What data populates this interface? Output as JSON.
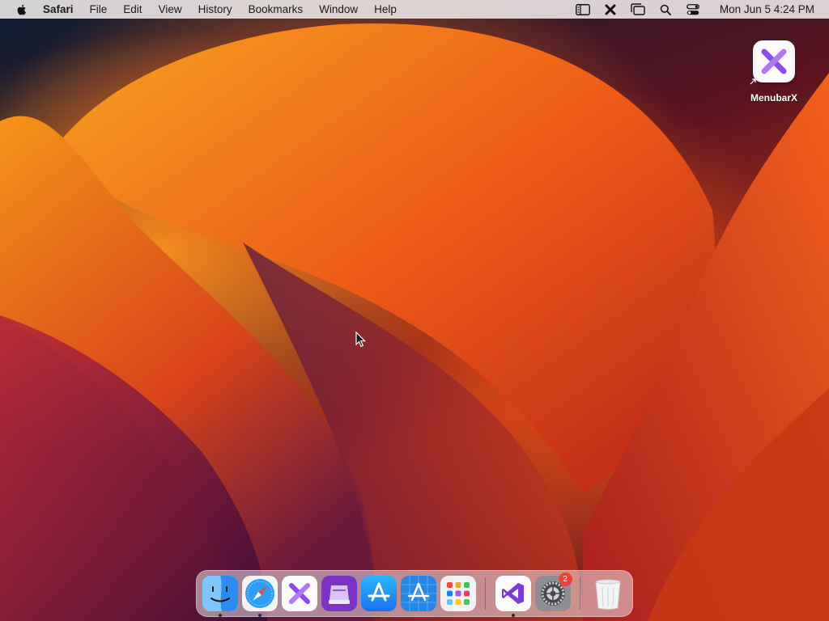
{
  "menubar": {
    "app_name": "Safari",
    "items": [
      "File",
      "Edit",
      "View",
      "History",
      "Bookmarks",
      "Window",
      "Help"
    ],
    "status_icons": [
      "sidebar-list-icon",
      "menubarx-icon",
      "window-stack-icon",
      "search-icon",
      "control-center-icon"
    ],
    "clock": "Mon Jun 5  4:24 PM"
  },
  "desktop": {
    "icon_label": "MenubarX"
  },
  "dock": {
    "apps": [
      {
        "name": "Finder",
        "icon": "finder-icon",
        "running": true
      },
      {
        "name": "Safari",
        "icon": "safari-icon",
        "running": true
      },
      {
        "name": "MenubarX",
        "icon": "menubarx-icon",
        "running": false
      },
      {
        "name": "Apple Configurator",
        "icon": "configurator-icon",
        "running": false
      },
      {
        "name": "App Store",
        "icon": "app-store-icon",
        "running": false
      },
      {
        "name": "Xcode Instruments",
        "icon": "app-store-blueprint-icon",
        "running": false
      },
      {
        "name": "Launchpad",
        "icon": "launchpad-icon",
        "running": false
      },
      {
        "name": "Visual Studio",
        "icon": "visual-studio-icon",
        "running": true
      },
      {
        "name": "System Settings",
        "icon": "settings-gear-icon",
        "running": false,
        "badge": "2"
      },
      {
        "name": "Trash",
        "icon": "trash-icon",
        "running": false
      }
    ]
  },
  "colors": {
    "menubar_bg": "#f0ebeb",
    "badge": "#f0413a",
    "menubarx_purple": "#8a4cf0"
  }
}
